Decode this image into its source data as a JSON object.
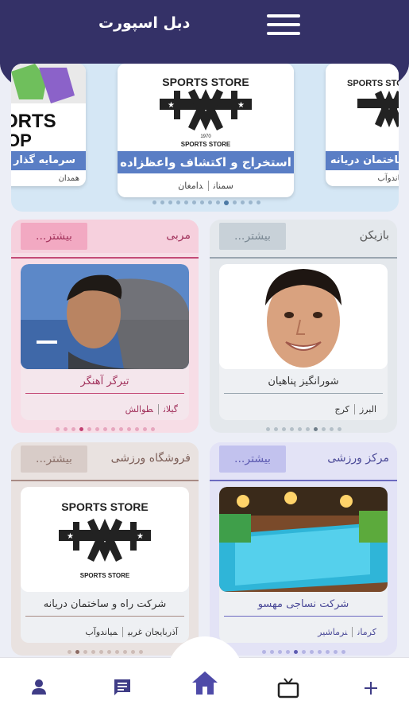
{
  "header": {
    "title": "دبل اسپورت",
    "menu_icon": "hamburger-menu-icon"
  },
  "slider": {
    "slides": [
      {
        "caption": "سرمایه گذار",
        "tags": [
          "همدان"
        ],
        "logo_text": "SPORTS SHOP"
      },
      {
        "caption": "استخراج و اکتشاف واعظزاده",
        "tags": [
          "سمنان",
          "دامغان"
        ],
        "logo_text": "SPORTS STORE",
        "logo_sub": "SPORTS STORE",
        "logo_year": "1970"
      },
      {
        "caption": "ساختمان دریانه",
        "tags": [
          "میاندوآب"
        ],
        "logo_text": "SPORTS STORE"
      }
    ],
    "dots_count": 14,
    "active_dot": 9
  },
  "categories": {
    "players": {
      "title": "بازیکن",
      "more": "بیشتر...",
      "item": {
        "name": "شورانگیز پناهیان",
        "province": "البرز",
        "city": "کرج"
      },
      "dots_count": 10,
      "active_dot": 6
    },
    "coaches": {
      "title": "مربی",
      "more": "بیشتر...",
      "item": {
        "name": "تیرگر آهنگر",
        "province": "گیلان",
        "city": "طوالش"
      },
      "dots_count": 13,
      "active_dot": 3
    },
    "centers": {
      "title": "مرکز ورزشی",
      "more": "بیشتر...",
      "item": {
        "name": "شرکت نساجی مهسو",
        "province": "کرمان",
        "city": "نرماشیر"
      },
      "dots_count": 11,
      "active_dot": 4
    },
    "stores": {
      "title": "فروشگاه ورزشی",
      "more": "بیشتر...",
      "item": {
        "name": "شرکت راه و ساختمان دریانه",
        "province": "آذربایجان غربی",
        "city": "میاندوآب",
        "logo_text": "SPORTS STORE",
        "logo_sub": "SPORTS STORE"
      },
      "dots_count": 10,
      "active_dot": 1
    }
  },
  "bottom_nav": {
    "items": [
      "person-icon",
      "chat-icon",
      "home-icon",
      "tv-icon",
      "plus-icon"
    ],
    "active": "home-icon"
  },
  "colors": {
    "header": "#343167",
    "slider_bg": "#d5e7f5",
    "caption_bg": "#5a7ec5",
    "pink_accent": "#c44b77",
    "lavender_accent": "#5e5cb2",
    "home_active": "#4e4aa8"
  }
}
